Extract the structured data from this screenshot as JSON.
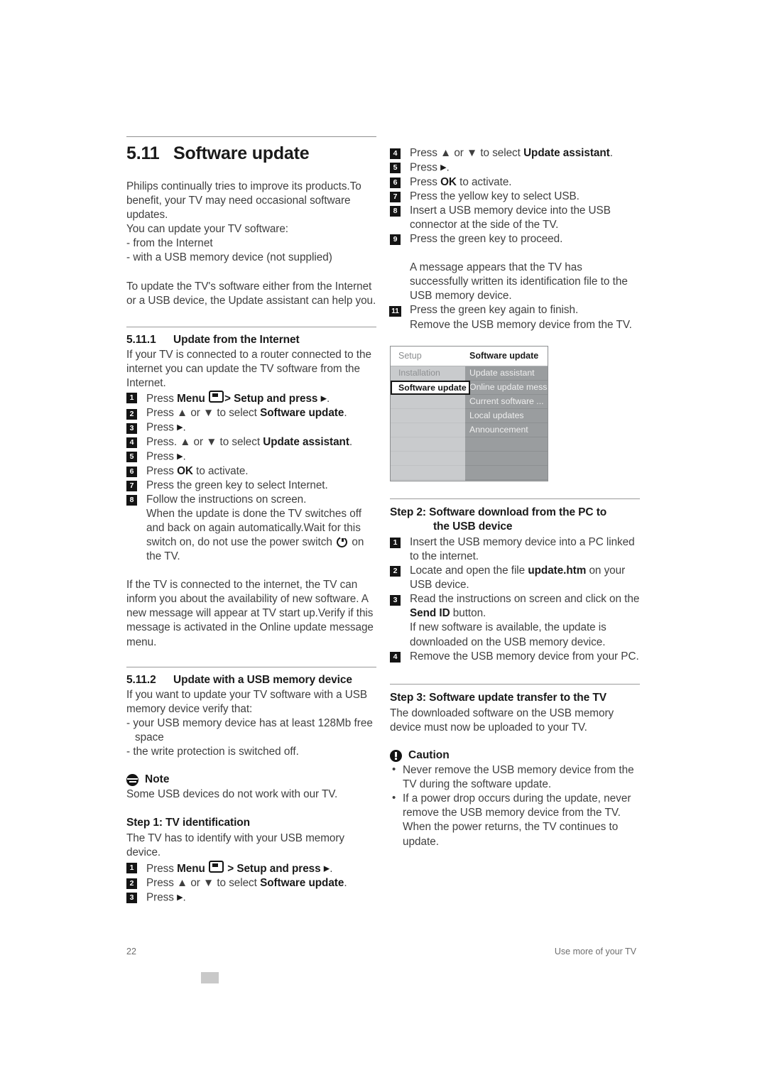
{
  "section": {
    "number": "5.11",
    "title": "Software update"
  },
  "intro": {
    "p1": "Philips continually tries to improve its products.To benefit, your TV may need occasional software updates.",
    "p2": "You can update your TV software:",
    "bullet1": "- from the Internet",
    "bullet2": "- with a USB memory device (not supplied)",
    "p3": "To update the TV's software either from the Internet or a USB device, the Update assistant can help you."
  },
  "internet": {
    "number": "5.11.1",
    "title": "Update from the Internet",
    "intro": "If your TV is connected to a router connected to the internet you can update the TV software from the Internet.",
    "steps": [
      {
        "n": "1",
        "pre": "Press ",
        "b1": "Menu",
        "icon": "menu-icon",
        "mid": "> Setup and press ",
        "arrow": "▶",
        "post": "."
      },
      {
        "n": "2",
        "pre": "Press ▲ or ▼ to select ",
        "b1": "Software update",
        "post": "."
      },
      {
        "n": "3",
        "pre": "Press ",
        "arrow": "▶",
        "post": "."
      },
      {
        "n": "4",
        "pre": "Press. ▲ or ▼ to select ",
        "b1": "Update assistant",
        "post": "."
      },
      {
        "n": "5",
        "pre": "Press ",
        "arrow": "▶",
        "post": "."
      },
      {
        "n": "6",
        "pre": "Press ",
        "b1": "OK",
        "post": " to activate."
      },
      {
        "n": "7",
        "pre": "Press the green key to select Internet."
      },
      {
        "n": "8",
        "pre": "Follow the instructions on screen."
      }
    ],
    "step8_cont_a": "When the update is done the TV switches off and back on again automatically.Wait for this switch on, do not use the power switch ",
    "step8_cont_b": " on the TV.",
    "after": "If the TV is connected to the internet, the TV can inform you about the availability of new software. A new message will appear at TV start up.Verify if this message is activated in the Online update message menu."
  },
  "usb": {
    "number": "5.11.2",
    "title": "Update with a USB memory device",
    "intro": "If you want to update your TV software with a USB memory device verify that:",
    "req1": "- your USB memory device has at least 128Mb free space",
    "req2": "- the write protection is switched off."
  },
  "note": {
    "icon": "note-icon",
    "title": "Note",
    "text": "Some USB devices do not work with our TV."
  },
  "step1": {
    "title": "Step 1: TV identification",
    "intro": "The TV has to identify with your USB memory device.",
    "steps": [
      {
        "n": "1",
        "pre": "Press ",
        "b1": "Menu",
        "icon": "menu-icon",
        "mid": "> ",
        "b2": "Setup and press ",
        "arrow": "▶",
        "post": "."
      },
      {
        "n": "2",
        "pre": "Press ▲ or ▼ to select ",
        "b1": "Software update",
        "post": "."
      },
      {
        "n": "3",
        "pre": "Press ",
        "arrow": "▶",
        "post": "."
      }
    ]
  },
  "right_steps": {
    "steps": [
      {
        "n": "4",
        "pre": "Press ▲ or ▼ to select ",
        "b1": "Update assistant",
        "post": "."
      },
      {
        "n": "5",
        "pre": "Press ",
        "arrow": "▶",
        "post": "."
      },
      {
        "n": "6",
        "pre": "Press ",
        "b1": "OK",
        "post": " to activate."
      },
      {
        "n": "7",
        "pre": "Press the yellow key to select USB."
      },
      {
        "n": "8",
        "pre": "Insert a USB memory device into the USB connector at the side of the TV."
      },
      {
        "n": "9",
        "pre": "Press the green key to proceed."
      }
    ],
    "message": "A message appears that the TV has successfully written its identification file to the USB memory device.",
    "step11": {
      "n": "11",
      "pre": "Press the green key again to finish."
    },
    "step11_cont": "Remove the USB memory device from the TV."
  },
  "tvmenu": {
    "header_left": "Setup",
    "header_right": "Software update",
    "left_items": [
      "Installation",
      "Software update",
      "",
      "",
      "",
      "",
      "",
      ""
    ],
    "left_selected_index": 1,
    "right_items": [
      "Update assistant",
      "Online update mess...",
      "Current software ...",
      "Local updates",
      "Announcement",
      "",
      "",
      ""
    ],
    "colors": {
      "panel_left": "#c9cbcd",
      "panel_right": "#9a9d9f",
      "header_bg": "#ffffff",
      "selected_bg": "#ffffff",
      "selected_border": "#171717"
    }
  },
  "step2": {
    "title_line1": "Step 2: Software download from the PC to",
    "title_line2": "the USB device",
    "steps": [
      {
        "n": "1",
        "pre": "Insert the USB memory device into a PC linked to the internet."
      },
      {
        "n": "2",
        "pre": "Locate and open the file ",
        "b1": "update.htm",
        "post": " on your USB device."
      },
      {
        "n": "3",
        "pre": "Read the instructions on screen and click on the ",
        "b1": "Send ID",
        "post": " button."
      },
      {
        "n": "4",
        "pre": "Remove the USB memory device from your PC."
      }
    ],
    "step3_cont": "If new software is available, the update is downloaded on the USB memory device."
  },
  "step3": {
    "title": "Step 3: Software update transfer to the TV",
    "intro": "The downloaded software on the USB memory device must now be uploaded to your TV."
  },
  "caution": {
    "icon": "caution-icon",
    "title": "Caution",
    "items": [
      "Never remove the USB memory device from the TV during the software update.",
      "If a power drop occurs during the update, never remove the USB memory device from the TV. When the power returns, the TV continues to update."
    ]
  },
  "footer": {
    "page_number": "22",
    "label": "Use more of your TV"
  }
}
